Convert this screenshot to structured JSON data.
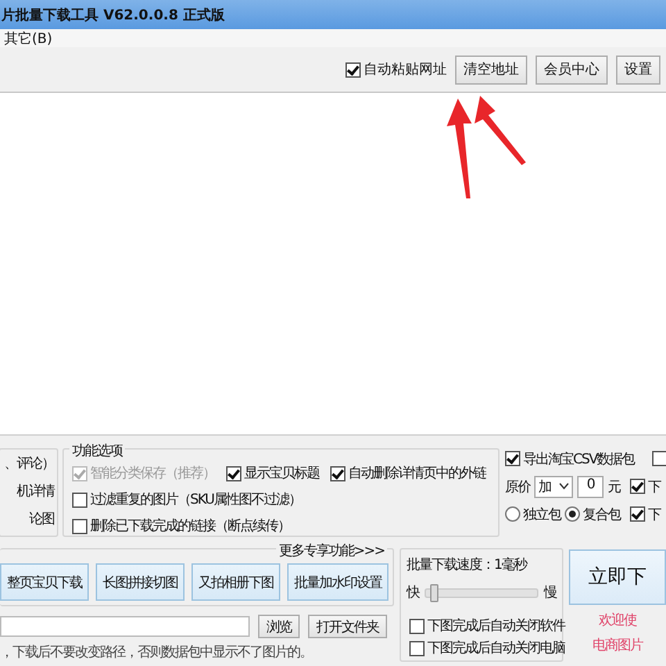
{
  "window": {
    "title": "片批量下载工具 V62.0.0.8 正式版"
  },
  "menu": [
    {
      "label": "其它(B)"
    }
  ],
  "toolbar": {
    "auto_paste": {
      "label": "自动粘贴网址",
      "checked": true
    },
    "buttons": [
      "清空地址",
      "会员中心",
      "设置"
    ]
  },
  "left_group": {
    "items": [
      "、评论）",
      "机详情",
      "论图"
    ]
  },
  "features": {
    "title": "功能选项",
    "options": [
      {
        "label": "智能分类保存（推荐）",
        "checked": true,
        "disabled": true
      },
      {
        "label": "显示宝贝标题",
        "checked": true,
        "disabled": false
      },
      {
        "label": "自动删除详情页中的外链",
        "checked": true,
        "disabled": false
      },
      {
        "label": "过滤重复的图片（SKU属性图不过滤）",
        "checked": false,
        "disabled": false
      },
      {
        "label": "删除已下载完成的链接（断点续传）",
        "checked": false,
        "disabled": false
      }
    ]
  },
  "export": {
    "csv": {
      "label": "导出淘宝CSV数据包",
      "checked": true
    },
    "corner_check": {
      "checked": false
    },
    "price": {
      "label": "原价",
      "op": "加",
      "value": "0",
      "unit": "元"
    },
    "side_checks": [
      {
        "label": "下",
        "checked": true
      },
      {
        "label": "下",
        "checked": true
      }
    ],
    "packages": [
      {
        "label": "独立包",
        "selected": false
      },
      {
        "label": "复合包",
        "selected": true
      }
    ]
  },
  "actions": {
    "more": "更多专享功能>>>",
    "buttons": [
      "整页宝贝下载",
      "长图拼接切图",
      "又拍相册下图",
      "批量加水印设置"
    ]
  },
  "path": {
    "browse": "浏览",
    "open_folder": "打开文件夹",
    "note": "，下载后不要改变路径，否则数据包中显示不了图片的。"
  },
  "speed": {
    "title": "批量下载速度：1毫秒",
    "fast": "快",
    "slow": "慢",
    "level": 0.04,
    "options": [
      {
        "label": "下图完成后自动关闭软件",
        "checked": false
      },
      {
        "label": "下图完成后自动关闭电脑",
        "checked": false
      }
    ]
  },
  "start_button": "立即下",
  "promo": [
    "欢迎使",
    "电商图片"
  ]
}
